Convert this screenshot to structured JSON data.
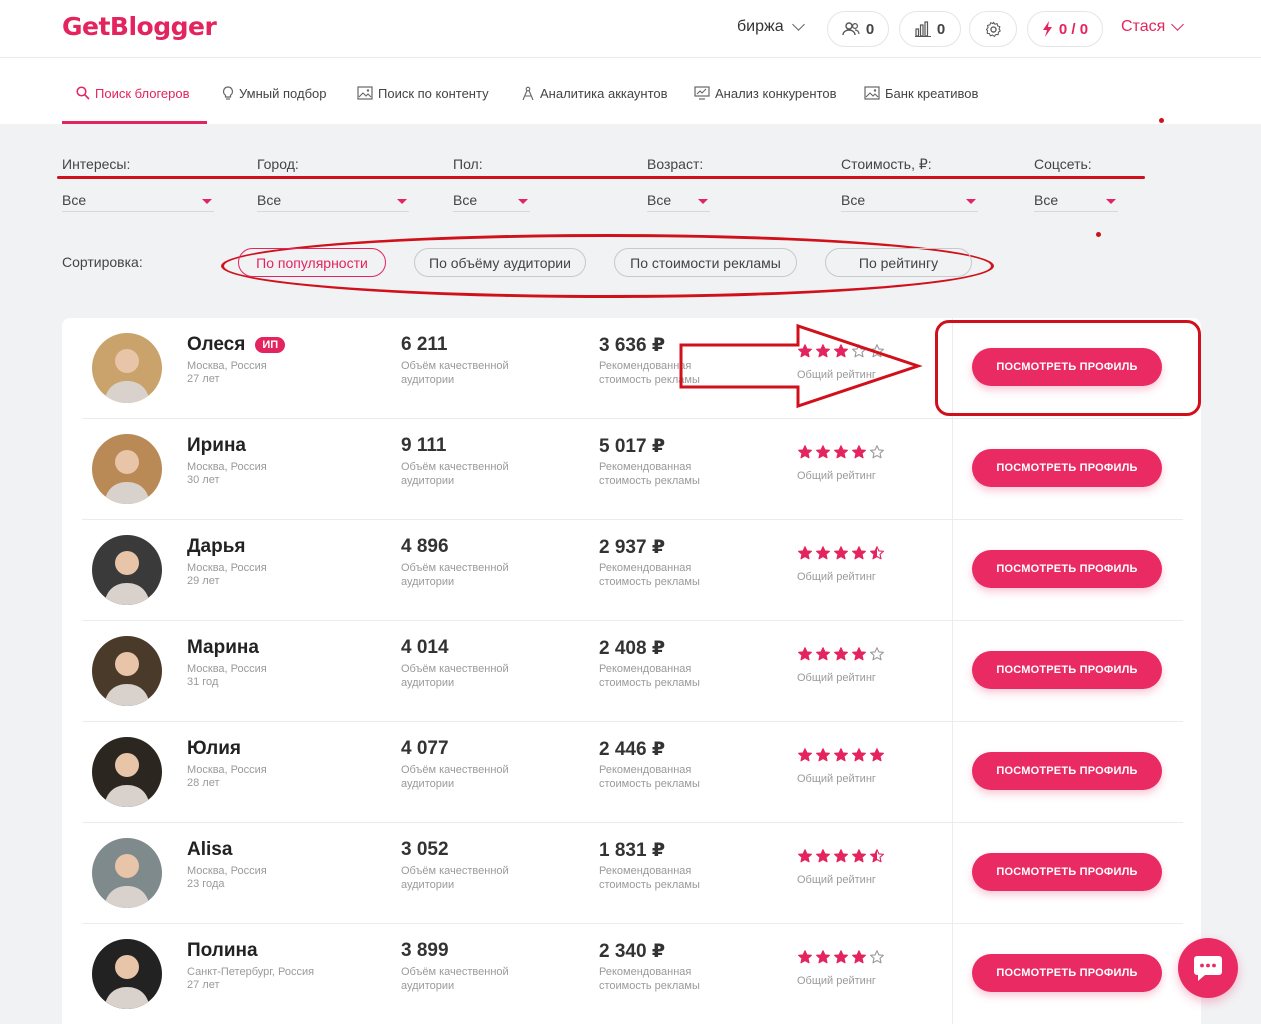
{
  "header": {
    "logo": "GetBlogger",
    "exchange_label": "биржа",
    "followers_count": "0",
    "stats_count": "0",
    "limits": "0 / 0",
    "user_name": "Стася"
  },
  "tabs": [
    {
      "label": "Поиск блогеров"
    },
    {
      "label": "Умный подбор"
    },
    {
      "label": "Поиск по контенту"
    },
    {
      "label": "Аналитика аккаунтов"
    },
    {
      "label": "Анализ конкурентов"
    },
    {
      "label": "Банк креативов"
    }
  ],
  "filters": [
    {
      "label": "Интересы:",
      "value": "Все"
    },
    {
      "label": "Город:",
      "value": "Все"
    },
    {
      "label": "Пол:",
      "value": "Все"
    },
    {
      "label": "Возраст:",
      "value": "Все"
    },
    {
      "label": "Стоимость, ₽:",
      "value": "Все"
    },
    {
      "label": "Соцсеть:",
      "value": "Все"
    }
  ],
  "sort": {
    "label": "Сортировка:",
    "options": [
      {
        "label": "По популярности",
        "active": true
      },
      {
        "label": "По объёму аудитории"
      },
      {
        "label": "По стоимости рекламы"
      },
      {
        "label": "По рейтингу"
      }
    ]
  },
  "captions": {
    "audience": "Объём качественной аудитории",
    "cost": "Рекомендованная стоимость рекламы",
    "rating": "Общий рейтинг",
    "button": "ПОСМОТРЕТЬ ПРОФИЛЬ"
  },
  "bloggers": [
    {
      "name": "Олеся",
      "badge": "ИП",
      "city": "Москва, Россия",
      "age": "27 лет",
      "audience": "6 211",
      "cost": "3 636 ₽",
      "rating": 3,
      "avatar_color": "#c9a36b"
    },
    {
      "name": "Ирина",
      "city": "Москва, Россия",
      "age": "30 лет",
      "audience": "9 111",
      "cost": "5 017 ₽",
      "rating": 4,
      "avatar_color": "#b98a56"
    },
    {
      "name": "Дарья",
      "city": "Москва, Россия",
      "age": "29 лет",
      "audience": "4 896",
      "cost": "2 937 ₽",
      "rating": 4.5,
      "avatar_color": "#3a3a3a"
    },
    {
      "name": "Марина",
      "city": "Москва, Россия",
      "age": "31 год",
      "audience": "4 014",
      "cost": "2 408 ₽",
      "rating": 4,
      "avatar_color": "#4a3a2a"
    },
    {
      "name": "Юлия",
      "city": "Москва, Россия",
      "age": "28 лет",
      "audience": "4 077",
      "cost": "2 446 ₽",
      "rating": 5,
      "avatar_color": "#2c2620"
    },
    {
      "name": "Alisa",
      "city": "Москва, Россия",
      "age": "23 года",
      "audience": "3 052",
      "cost": "1 831 ₽",
      "rating": 4.5,
      "avatar_color": "#7f8a8c"
    },
    {
      "name": "Полина",
      "city": "Санкт-Петербург, Россия",
      "age": "27 лет",
      "audience": "3 899",
      "cost": "2 340 ₽",
      "rating": 4,
      "avatar_color": "#222222"
    }
  ],
  "colors": {
    "brand": "#e3245e",
    "annotation": "#d0111b",
    "star_empty": "#9a9a9a"
  }
}
